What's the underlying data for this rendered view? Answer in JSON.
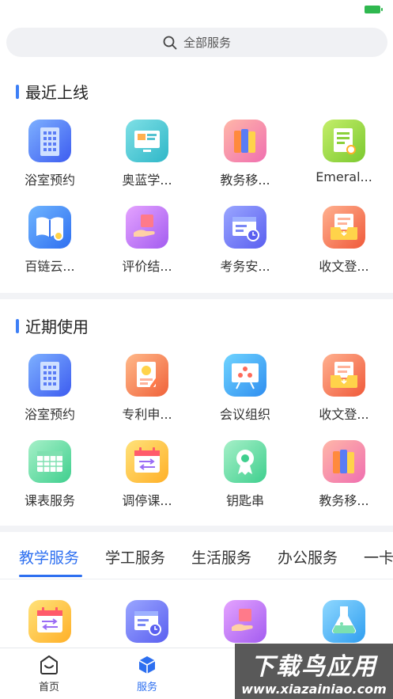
{
  "status_bar": {
    "battery_color": "#2fb84f"
  },
  "search": {
    "label": "全部服务",
    "icon": "search-icon"
  },
  "recent_online": {
    "title": "最近上线",
    "items": [
      {
        "label": "浴室预约",
        "icon": "building-icon"
      },
      {
        "label": "奥蓝学...",
        "icon": "monitor-icon"
      },
      {
        "label": "教务移...",
        "icon": "books-icon"
      },
      {
        "label": "Emeral...",
        "icon": "document-search-icon"
      },
      {
        "label": "百链云...",
        "icon": "book-search-icon"
      },
      {
        "label": "评价结...",
        "icon": "hand-box-icon"
      },
      {
        "label": "考务安...",
        "icon": "calendar-clock-icon"
      },
      {
        "label": "收文登...",
        "icon": "inbox-icon"
      }
    ]
  },
  "recent_used": {
    "title": "近期使用",
    "items": [
      {
        "label": "浴室预约",
        "icon": "building-icon"
      },
      {
        "label": "专利申...",
        "icon": "patent-document-icon"
      },
      {
        "label": "会议组织",
        "icon": "meeting-board-icon"
      },
      {
        "label": "收文登...",
        "icon": "inbox-icon"
      },
      {
        "label": "课表服务",
        "icon": "timetable-icon"
      },
      {
        "label": "调停课...",
        "icon": "calendar-swap-icon"
      },
      {
        "label": "钥匙串",
        "icon": "key-badge-icon"
      },
      {
        "label": "教务移...",
        "icon": "books-icon"
      }
    ]
  },
  "tabs": [
    {
      "label": "教学服务",
      "active": true
    },
    {
      "label": "学工服务",
      "active": false
    },
    {
      "label": "生活服务",
      "active": false
    },
    {
      "label": "办公服务",
      "active": false
    },
    {
      "label": "一卡",
      "active": false
    }
  ],
  "teaching_items": [
    {
      "icon": "calendar-swap-icon"
    },
    {
      "icon": "calendar-clock-icon"
    },
    {
      "icon": "hand-box-icon"
    },
    {
      "icon": "flask-icon"
    }
  ],
  "bottom_nav": [
    {
      "label": "首页",
      "icon": "home-face-icon",
      "active": false
    },
    {
      "label": "服务",
      "icon": "cube-icon",
      "active": true
    }
  ],
  "watermark": {
    "line1": "下载鸟应用",
    "line2": "www.xiazainiao.com"
  },
  "colors": {
    "accent": "#2d6ff0",
    "section_bar": "#3d7ff6"
  }
}
